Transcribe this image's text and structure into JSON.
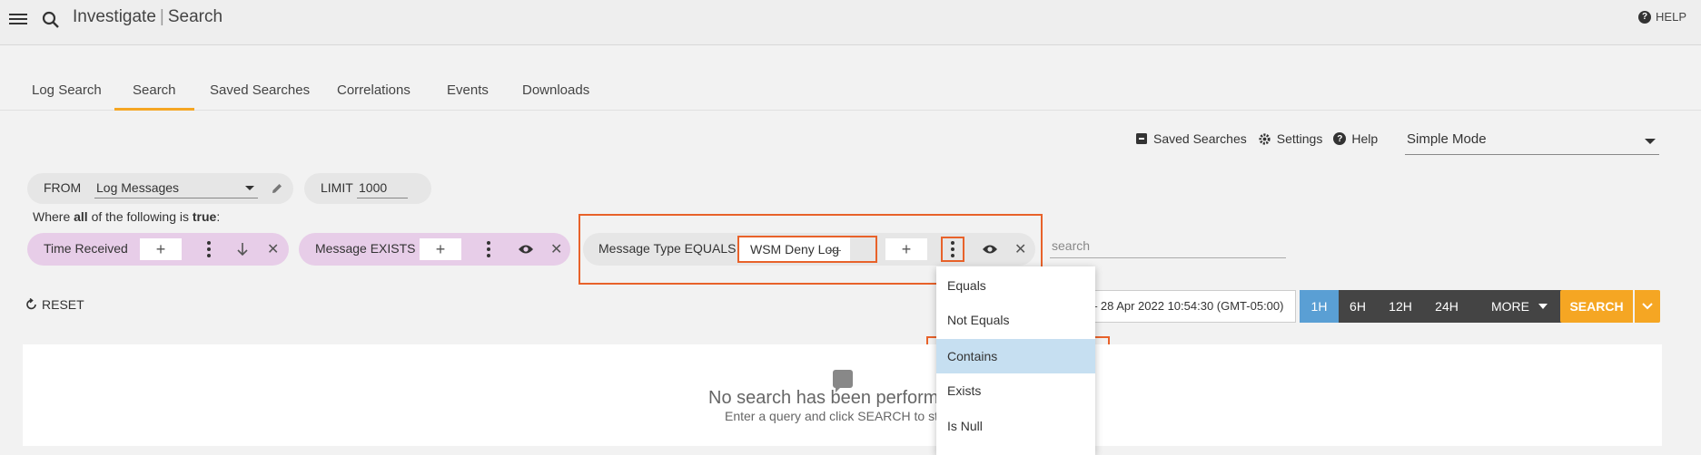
{
  "topbar": {
    "app_name": "Investigate",
    "page_name": "Search",
    "help_label": "HELP"
  },
  "tabs": [
    {
      "label": "Log Search"
    },
    {
      "label": "Search"
    },
    {
      "label": "Saved Searches"
    },
    {
      "label": "Correlations"
    },
    {
      "label": "Events"
    },
    {
      "label": "Downloads"
    }
  ],
  "active_tab": "Search",
  "toolbar": {
    "saved_searches_label": "Saved Searches",
    "settings_label": "Settings",
    "help_label": "Help",
    "mode_value": "Simple Mode"
  },
  "query": {
    "from_label": "FROM",
    "from_value": "Log Messages",
    "limit_label": "LIMIT",
    "limit_value": "1000",
    "where_prefix": "Where ",
    "where_all": "all",
    "where_mid": " of the following is ",
    "where_true": "true",
    "where_suffix": ":",
    "conditions": [
      {
        "label": "Time Received"
      },
      {
        "label": "Message EXISTS"
      },
      {
        "label": "Message Type EQUALS",
        "value": "WSM Deny Log"
      }
    ],
    "search_placeholder": "search"
  },
  "actions": {
    "reset_label": "RESET",
    "date_range": "– 28 Apr 2022 10:54:30 (GMT-05:00)",
    "ranges": [
      "1H",
      "6H",
      "12H",
      "24H",
      "MORE"
    ],
    "active_range": "1H",
    "search_label": "SEARCH"
  },
  "results": {
    "empty_title": "No search has been performe",
    "empty_sub": "Enter a query and click SEARCH to st"
  },
  "operator_dropdown": {
    "items": [
      "Equals",
      "Not Equals",
      "Contains",
      "Exists",
      "Is Null"
    ],
    "selected": "Contains"
  },
  "colors": {
    "accent": "#f5a623",
    "highlight_box": "#e8622a",
    "condition_pill": "#e7cde8",
    "active_range": "#5a9fd4",
    "selected_item": "#c6dff1"
  }
}
